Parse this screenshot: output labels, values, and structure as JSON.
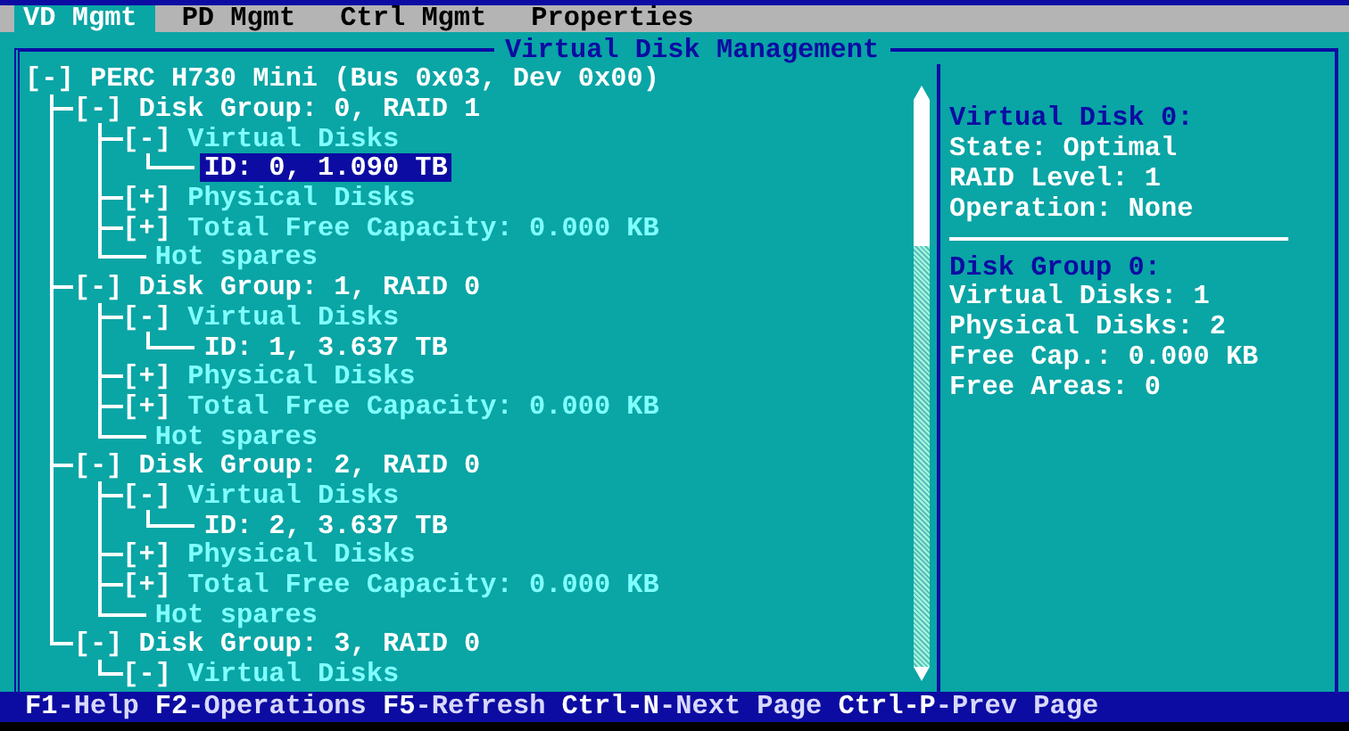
{
  "tabs": [
    {
      "label": "VD Mgmt",
      "selected": true
    },
    {
      "label": "PD Mgmt",
      "selected": false
    },
    {
      "label": "Ctrl Mgmt",
      "selected": false
    },
    {
      "label": "Properties",
      "selected": false
    }
  ],
  "panel_title": "Virtual Disk Management",
  "tree": [
    {
      "kind": "item",
      "toggle": "[-]",
      "label": "PERC H730 Mini (Bus 0x03, Dev 0x00)",
      "selected": false,
      "children": [
        {
          "kind": "item",
          "toggle": "[-]",
          "label": "Disk Group: 0, RAID 1",
          "selected": false,
          "children": [
            {
              "kind": "category",
              "toggle": "[-]",
              "label": "Virtual Disks",
              "selected": false,
              "children": [
                {
                  "kind": "item",
                  "label": "ID: 0, 1.090 TB",
                  "selected": true
                }
              ]
            },
            {
              "kind": "category",
              "toggle": "[+]",
              "label": "Physical Disks",
              "selected": false
            },
            {
              "kind": "category",
              "toggle": "[+]",
              "label": "Total Free Capacity: 0.000 KB",
              "selected": false
            },
            {
              "kind": "category",
              "label": "Hot spares",
              "selected": false
            }
          ]
        },
        {
          "kind": "item",
          "toggle": "[-]",
          "label": "Disk Group: 1, RAID 0",
          "selected": false,
          "children": [
            {
              "kind": "category",
              "toggle": "[-]",
              "label": "Virtual Disks",
              "selected": false,
              "children": [
                {
                  "kind": "item",
                  "label": "ID: 1, 3.637 TB",
                  "selected": false
                }
              ]
            },
            {
              "kind": "category",
              "toggle": "[+]",
              "label": "Physical Disks",
              "selected": false
            },
            {
              "kind": "category",
              "toggle": "[+]",
              "label": "Total Free Capacity: 0.000 KB",
              "selected": false
            },
            {
              "kind": "category",
              "label": "Hot spares",
              "selected": false
            }
          ]
        },
        {
          "kind": "item",
          "toggle": "[-]",
          "label": "Disk Group: 2, RAID 0",
          "selected": false,
          "children": [
            {
              "kind": "category",
              "toggle": "[-]",
              "label": "Virtual Disks",
              "selected": false,
              "children": [
                {
                  "kind": "item",
                  "label": "ID: 2, 3.637 TB",
                  "selected": false
                }
              ]
            },
            {
              "kind": "category",
              "toggle": "[+]",
              "label": "Physical Disks",
              "selected": false
            },
            {
              "kind": "category",
              "toggle": "[+]",
              "label": "Total Free Capacity: 0.000 KB",
              "selected": false
            },
            {
              "kind": "category",
              "label": "Hot spares",
              "selected": false
            }
          ]
        },
        {
          "kind": "item",
          "toggle": "[-]",
          "label": "Disk Group: 3, RAID 0",
          "selected": false,
          "children": [
            {
              "kind": "category",
              "toggle": "[-]",
              "label": "Virtual Disks",
              "selected": false
            }
          ]
        }
      ]
    }
  ],
  "details": [
    {
      "kind": "heading",
      "text": "Virtual Disk 0:"
    },
    {
      "kind": "line",
      "text": "State: Optimal"
    },
    {
      "kind": "line",
      "text": "RAID Level: 1"
    },
    {
      "kind": "line",
      "text": "Operation: None"
    },
    {
      "kind": "rule"
    },
    {
      "kind": "heading",
      "text": "Disk Group 0:"
    },
    {
      "kind": "line",
      "text": "Virtual Disks: 1"
    },
    {
      "kind": "line",
      "text": "Physical Disks: 2"
    },
    {
      "kind": "line",
      "text": "Free Cap.: 0.000 KB"
    },
    {
      "kind": "line",
      "text": "Free Areas: 0"
    }
  ],
  "status_bar": [
    {
      "key": "F1",
      "action": "-Help"
    },
    {
      "key": "F2",
      "action": "-Operations"
    },
    {
      "key": "F5",
      "action": "-Refresh"
    },
    {
      "key": "Ctrl-N",
      "action": "-Next Page"
    },
    {
      "key": "Ctrl-P",
      "action": "-Prev Page"
    }
  ]
}
